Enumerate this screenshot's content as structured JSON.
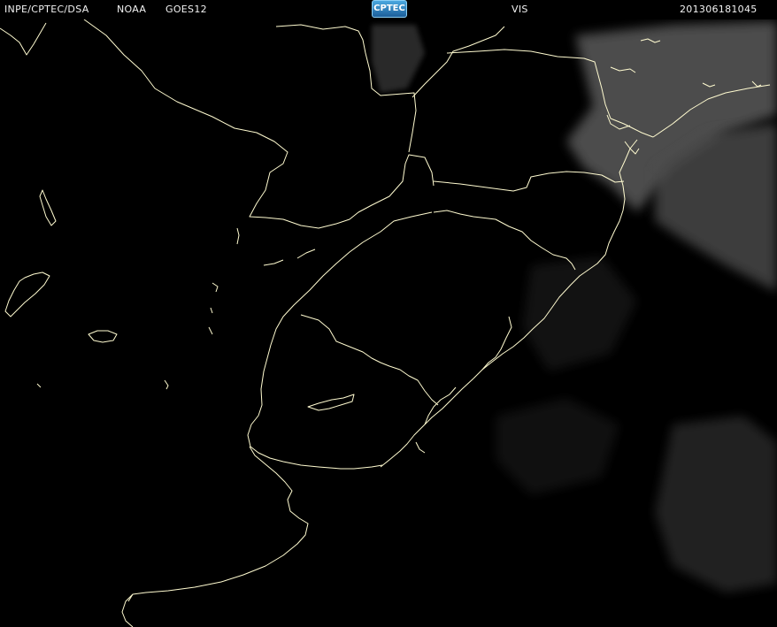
{
  "header": {
    "source": "INPE/CPTEC/DSA",
    "agency": "NOAA",
    "satellite": "GOES12",
    "channel": "VIS",
    "timestamp": "201306181045"
  },
  "logo": {
    "text": "CPTEC"
  },
  "colors": {
    "background": "#000000",
    "coastline": "#fffbd0",
    "header_text": "#f2f2f2",
    "cloud": "#5a5a5a"
  }
}
